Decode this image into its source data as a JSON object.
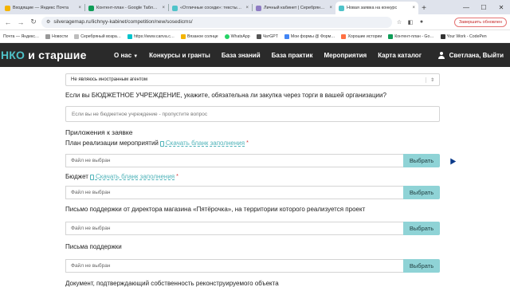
{
  "browser": {
    "tabs": [
      {
        "title": "Входящие — Яндекс Почта",
        "color": "#f4b400",
        "active": false
      },
      {
        "title": "Контент-план - Google Табл…",
        "color": "#0f9d58",
        "active": false
      },
      {
        "title": "«Отличные соседи»: тексты…",
        "color": "#4fc3c9",
        "active": false
      },
      {
        "title": "Личный кабинет | Серебрян…",
        "color": "#8e7cc3",
        "active": false
      },
      {
        "title": "Новая заявка на конкурс",
        "color": "#4fc3c9",
        "active": true
      }
    ],
    "new_tab": "+",
    "url": "silveragemap.ru/lichnyy-kabinet/competition/new/sosedicms/",
    "update_button": "Завершить обновлен",
    "bookmarks": [
      {
        "label": "",
        "color": "#ff5a5a"
      },
      {
        "label": "Новости",
        "color": "#999"
      },
      {
        "label": "Серебряный возра…",
        "color": "#e0e0e0"
      },
      {
        "label": "https://www.canva.c…",
        "color": "#00c4cc"
      },
      {
        "label": "Вязаное солнце",
        "color": "#f4b400"
      },
      {
        "label": "WhatsApp",
        "color": "#25d366"
      },
      {
        "label": "ЧатGPT",
        "color": "#555"
      },
      {
        "label": "Мои формы @ Форм…",
        "color": "#4285f4"
      },
      {
        "label": "Хорошие истории",
        "color": "#ff7043"
      },
      {
        "label": "Контент-план - Go…",
        "color": "#0f9d58"
      },
      {
        "label": "Your Work - CodePen",
        "color": "#333"
      }
    ],
    "bookmark_first": "Почта — Яндекс…"
  },
  "site": {
    "logo_highlight": "НКО",
    "logo_rest": " и старшие",
    "menu": [
      {
        "label": "О нас",
        "has_caret": true
      },
      {
        "label": "Конкурсы и гранты"
      },
      {
        "label": "База знаний"
      },
      {
        "label": "База практик"
      },
      {
        "label": "Мероприятия"
      },
      {
        "label": "Карта каталог"
      }
    ],
    "user_label": "Светлана, Выйти"
  },
  "form": {
    "agent_select": "Не являюсь иностранным агентом",
    "budget_question": "Если вы БЮДЖЕТНОЕ УЧРЕЖДЕНИЕ, укажите, обязательна ли закупка через торги в вашей организации?",
    "budget_placeholder": "Если вы не бюджетное учреждение - пропустите вопрос",
    "attachments_title": "Приложения к заявке",
    "plan_label": "План реализации мероприятий",
    "download_link": "Скачать бланк заполнения",
    "budget_label": "Бюджет",
    "support_letter_label": "Письмо поддержки от директора магазина «Пятёрочка», на территории которого реализуется проект",
    "support_letters_label": "Письма поддержки",
    "ownership_label": "Документ, подтверждающий собственность реконструируемого объекта",
    "no_file": "Файл не выбран",
    "choose_button": "Выбрать",
    "required_mark": "*"
  }
}
